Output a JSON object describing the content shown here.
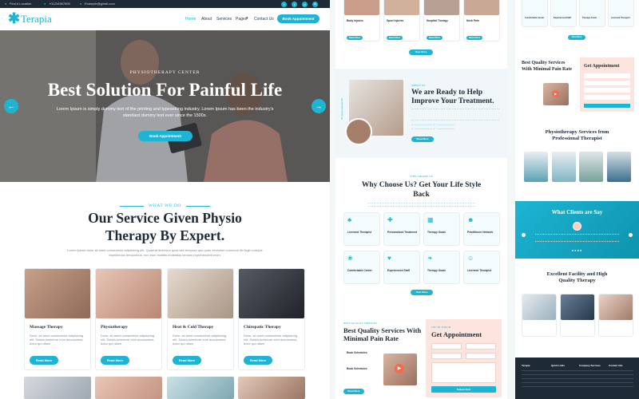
{
  "topbar": {
    "address": "Find A Location",
    "phone": "+01234567890",
    "email": "Example@gmail.com",
    "social": [
      "f",
      "t",
      "p",
      "in"
    ]
  },
  "header": {
    "logo": "Terapia",
    "nav": [
      "Home",
      "About",
      "Services",
      "Pages",
      "Contact Us"
    ],
    "cta": "Book Appointment"
  },
  "hero": {
    "eyebrow": "PHYSIOTHERAPY CENTER",
    "title": "Best Solution For Painful Life",
    "text": "Lorem Ipsum is simply dummy text of the printing and typesetting industry. Lorem Ipsum has been the industry's standard dummy text ever since the 1500s.",
    "button": "Book Appointment",
    "prev": "←",
    "next": "→"
  },
  "services": {
    "eyebrow": "WHAT WE DO",
    "title_line1": "Our Service Given Physio",
    "title_line2": "Therapy By Expert.",
    "text": "Lorem ipsum dolor sit amet consectetur adipisicing elit. Quaerat deserunt quos iste tempora quo quas excepturi commodi illo fugit cumque repellendus temporibus, non eum mollitia molestias veniam reprehenderit enim.",
    "cards": [
      {
        "title": "Massage Therapy",
        "text": "Dolor, sit amet consectetur adipisicing elit. Soluta inventore cum accusamus, dolor qui ullam",
        "button": "Read More",
        "color": "#c8a08a"
      },
      {
        "title": "Physiotherapy",
        "text": "Dolor, sit amet consectetur adipisicing elit. Soluta inventore cum accusamus, dolor qui ullam",
        "button": "Read More",
        "color": "#d7b2a0"
      },
      {
        "title": "Heat & Cold Therapy",
        "text": "Dolor, sit amet consectetur adipisicing elit. Soluta inventore cum accusamus, dolor qui ullam",
        "button": "Read More",
        "color": "#cbb9a7"
      },
      {
        "title": "Chiropatic Therapy",
        "text": "Dolor, sit amet consectetur adipisicing elit. Soluta inventore cum accusamus, dolor qui ullam",
        "button": "Read More",
        "color": "#3a3d44"
      }
    ]
  },
  "col2": {
    "top_cards": [
      {
        "title": "Body Injuries",
        "button": "Read More"
      },
      {
        "title": "Sport Injuries",
        "button": "Read More"
      },
      {
        "title": "Hospital Therapy",
        "button": "Read More"
      },
      {
        "title": "Neck Pain",
        "button": "Read More"
      }
    ],
    "view_more": "View More",
    "about_eyebrow": "ABOUT US",
    "about_title": "We are Ready to Help Improve Your Treatment.",
    "about_side": "25 years experience",
    "about_button": "Read More",
    "why_eyebrow": "WHY CHOOSE US",
    "why_title": "Why Choose Us? Get Your Life Style Back",
    "features": [
      "Licensed Therapist",
      "Personalized Treatment",
      "Therapy Goals",
      "Practitioner Network",
      "Comfortable Center",
      "Experienced Staff",
      "Therapy Goals",
      "Licensed Therapist"
    ],
    "why_button": "View More",
    "bq_eyebrow": "BEST QUALITY SERVICES",
    "bq_title": "Best Quality Services With Minimal Pain Rate",
    "bq_items": [
      "Book Schedules",
      "Book Schedules"
    ],
    "bq_button": "Read More",
    "appt_eyebrow": "GET IN TOUCH",
    "appt_title": "Get Appointment",
    "appt_button": "Submit Now"
  },
  "col3": {
    "top_cards": [
      "Comfortable Center",
      "Experienced Staff",
      "Therapy Goals",
      "Licensed Therapist"
    ],
    "view_more": "View More",
    "bq_title": "Best Quality Services With Minimal Pain Rate",
    "appt_title": "Get Appointment",
    "team_title": "Physiotherapy Services from Professional Therapist",
    "clients_title": "What Clients are Say",
    "facility_title": "Excellent Facility and High Quality Therapy",
    "footer_heads": [
      "Terapia",
      "Quick Links",
      "Company Services",
      "Contact Info"
    ]
  },
  "colors": {
    "accent": "#1db5d3",
    "dark": "#1e2a36",
    "peach": "#fde5df"
  }
}
